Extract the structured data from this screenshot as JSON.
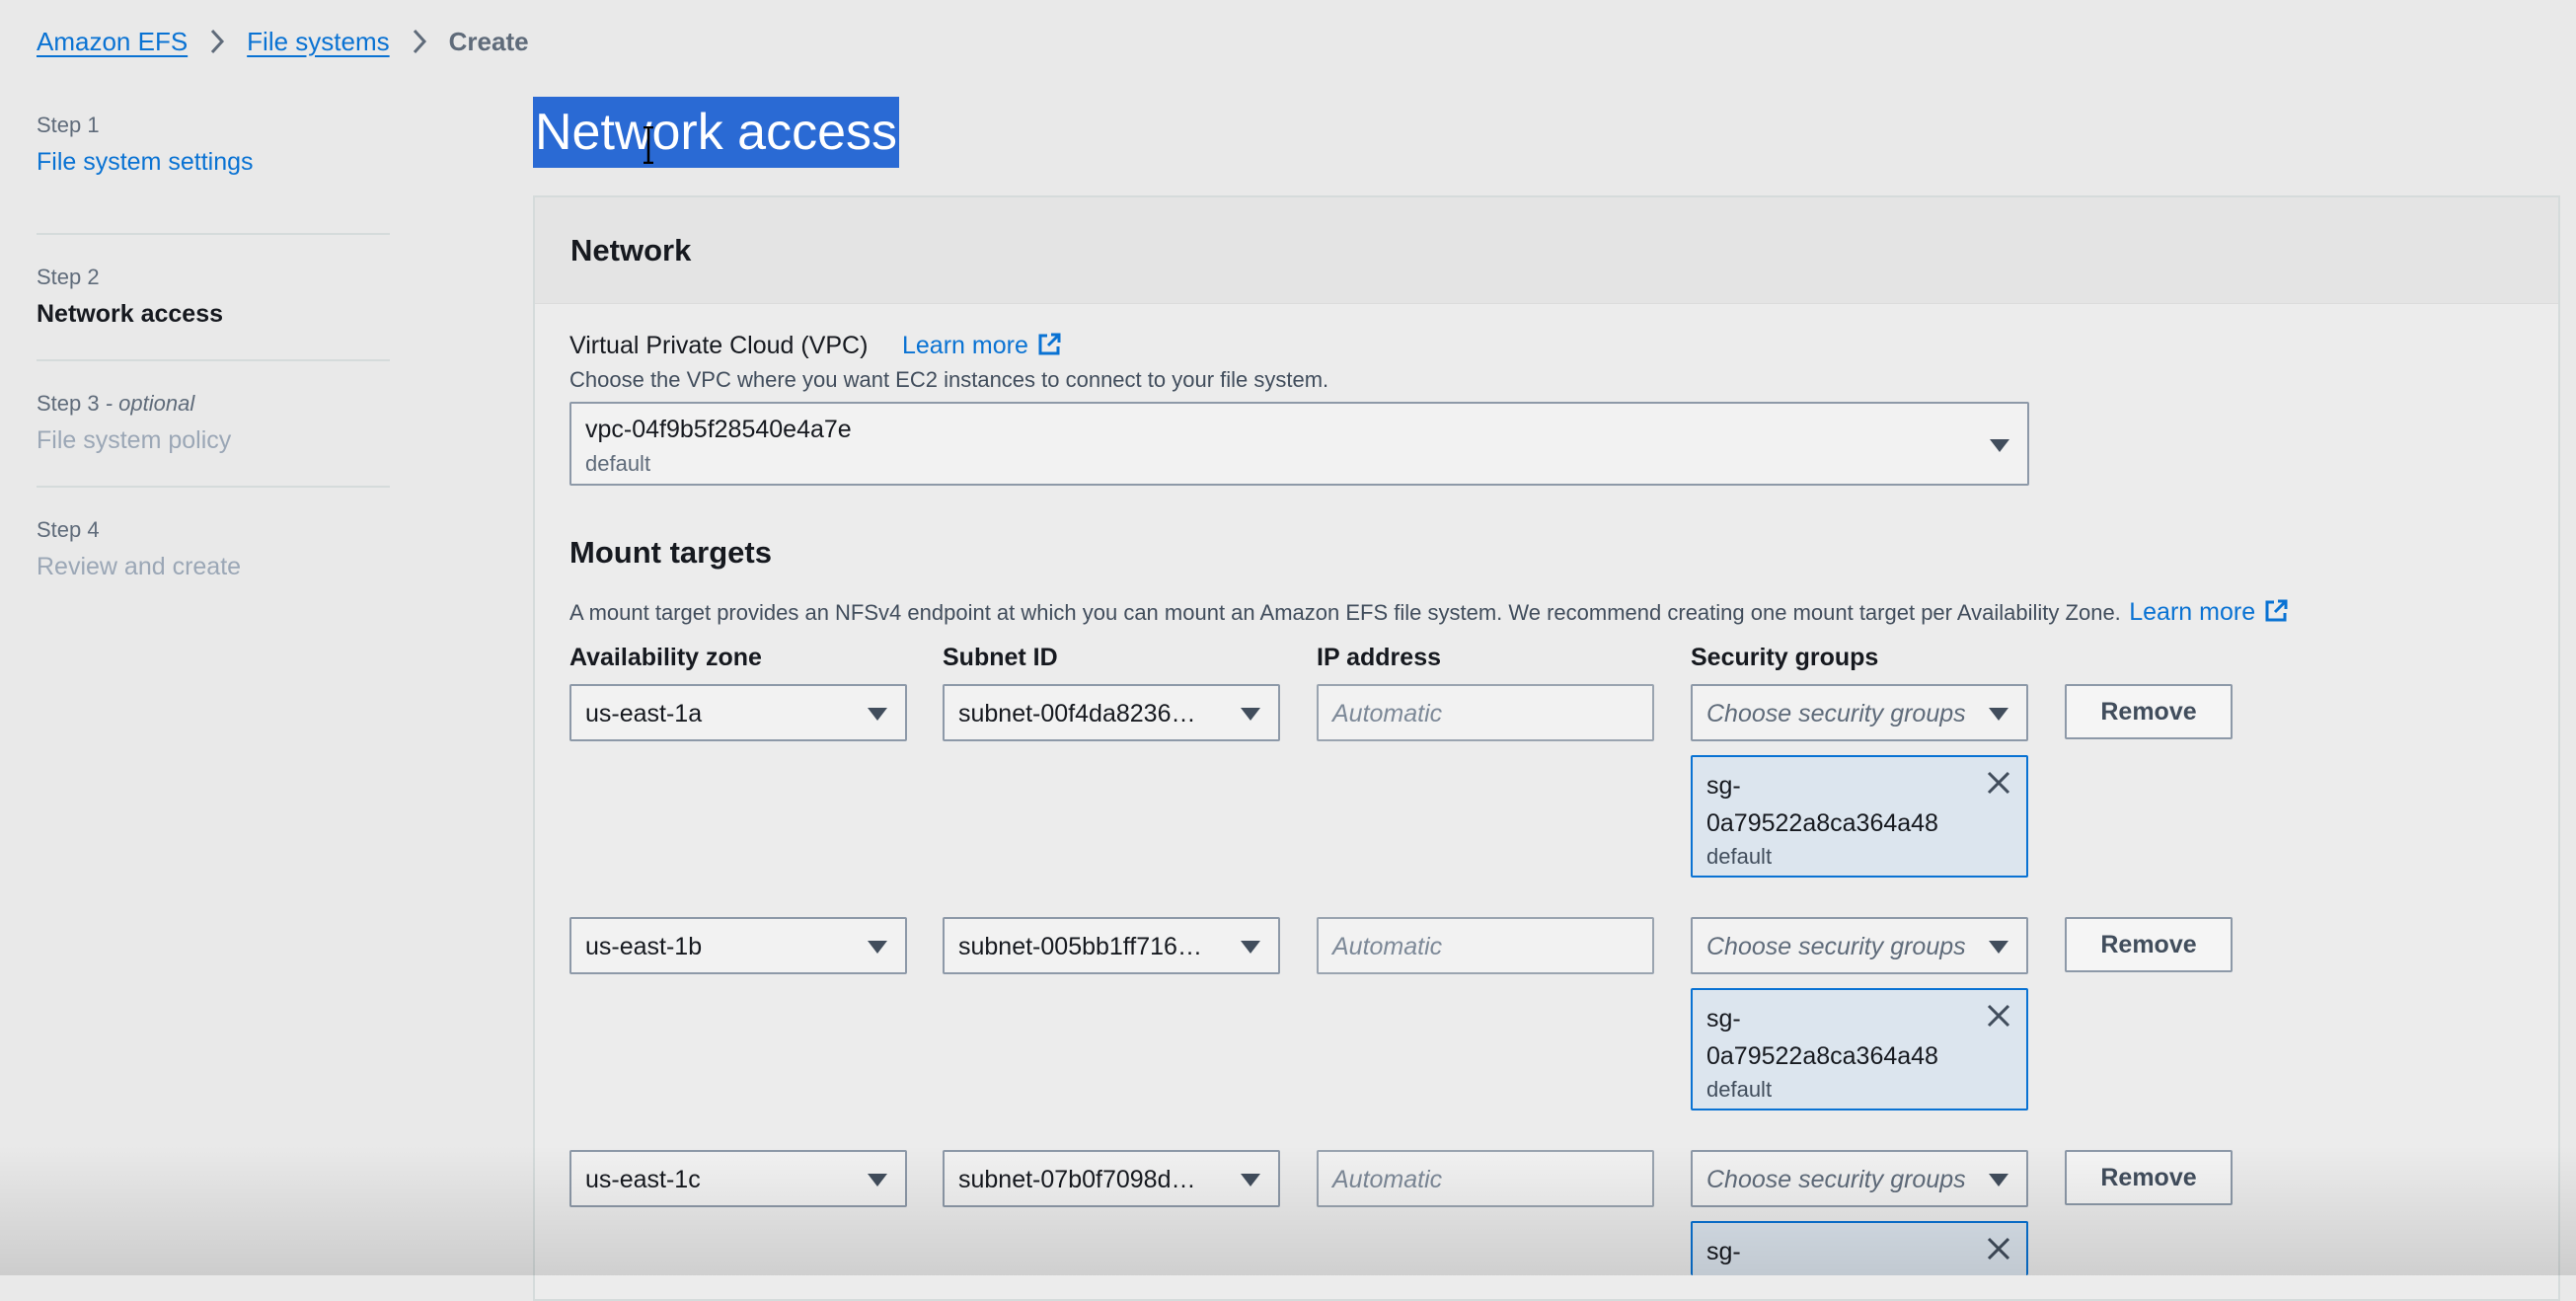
{
  "breadcrumb": {
    "items": [
      "Amazon EFS",
      "File systems"
    ],
    "current": "Create"
  },
  "steps": [
    {
      "num": "Step 1",
      "num_suffix": "",
      "title": "File system settings",
      "state": "link"
    },
    {
      "num": "Step 2",
      "num_suffix": "",
      "title": "Network access",
      "state": "active"
    },
    {
      "num": "Step 3",
      "num_suffix": " - optional",
      "title": "File system policy",
      "state": "disabled"
    },
    {
      "num": "Step 4",
      "num_suffix": "",
      "title": "Review and create",
      "state": "disabled"
    }
  ],
  "page": {
    "title": "Network access"
  },
  "network": {
    "header": "Network",
    "vpc_label": "Virtual Private Cloud (VPC)",
    "learn_more": "Learn more",
    "vpc_desc": "Choose the VPC where you want EC2 instances to connect to your file system.",
    "vpc_value": "vpc-04f9b5f28540e4a7e",
    "vpc_sub": "default"
  },
  "mount": {
    "header": "Mount targets",
    "desc": "A mount target provides an NFSv4 endpoint at which you can mount an Amazon EFS file system. We recommend creating one mount target per Availability Zone.",
    "learn_more": "Learn more",
    "columns": [
      "Availability zone",
      "Subnet ID",
      "IP address",
      "Security groups"
    ],
    "ip_placeholder": "Automatic",
    "sg_placeholder": "Choose security groups",
    "remove_label": "Remove",
    "rows": [
      {
        "az": "us-east-1a",
        "subnet": "subnet-00f4da8236…",
        "sg_id": "sg-0a79522a8ca364a48",
        "sg_line1": "sg-",
        "sg_line2": "0a79522a8ca364a48",
        "sg_desc": "default"
      },
      {
        "az": "us-east-1b",
        "subnet": "subnet-005bb1ff716…",
        "sg_id": "sg-0a79522a8ca364a48",
        "sg_line1": "sg-",
        "sg_line2": "0a79522a8ca364a48",
        "sg_desc": "default"
      },
      {
        "az": "us-east-1c",
        "subnet": "subnet-07b0f7098d…",
        "sg_id": "sg-",
        "sg_line1": "sg-",
        "sg_line2": "",
        "sg_desc": ""
      }
    ]
  },
  "colors": {
    "link": "#0972d3",
    "selection": "#2a6ad4",
    "token_bg": "#dce5ee"
  }
}
